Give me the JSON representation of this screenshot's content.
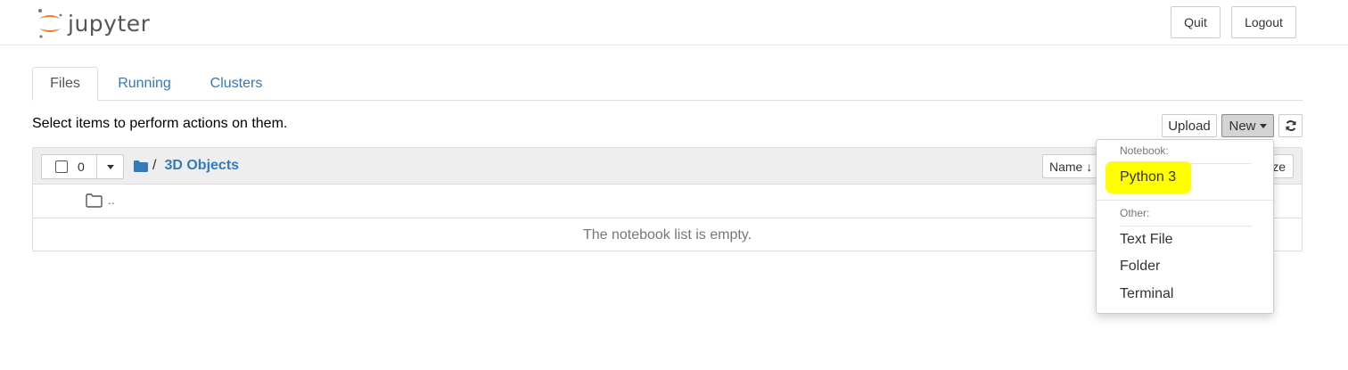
{
  "app": {
    "logo_text": "jupyter"
  },
  "header": {
    "quit_label": "Quit",
    "logout_label": "Logout"
  },
  "tabs": [
    {
      "label": "Files",
      "active": true
    },
    {
      "label": "Running",
      "active": false
    },
    {
      "label": "Clusters",
      "active": false
    }
  ],
  "toolbar": {
    "instructions": "Select items to perform actions on them.",
    "upload_label": "Upload",
    "new_label": "New",
    "refresh_icon": "refresh-icon"
  },
  "list": {
    "selected_count": "0",
    "breadcrumb_separator": "/",
    "current_folder": "3D Objects",
    "sort_name_label": "Name",
    "sort_size_label": "ze",
    "up_dir_label": "..",
    "empty_message": "The notebook list is empty."
  },
  "new_menu": {
    "notebook_header": "Notebook:",
    "notebook_items": [
      "Python 3"
    ],
    "other_header": "Other:",
    "other_items": [
      "Text File",
      "Folder",
      "Terminal"
    ],
    "highlight_color": "#ffff00"
  },
  "colors": {
    "link": "#337ab7",
    "logo_orange": "#f37726",
    "logo_gray": "#767677"
  }
}
